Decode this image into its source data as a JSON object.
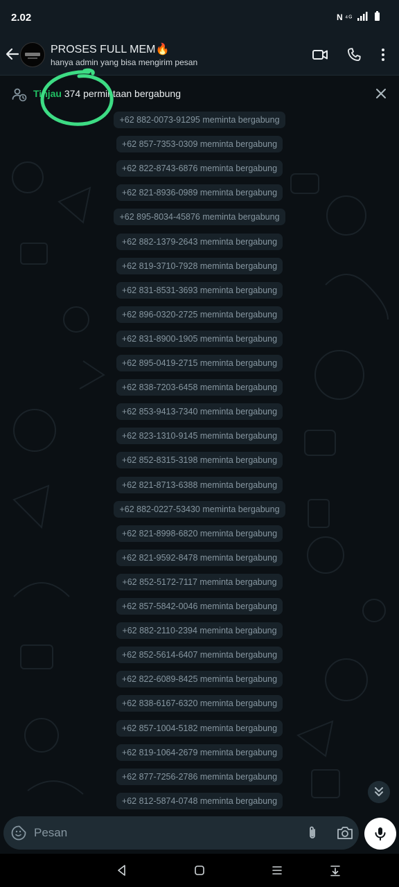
{
  "status_bar": {
    "time": "2.02",
    "icons_text": "N ⁴ᴳ 📶"
  },
  "header": {
    "title": "PROSES FULL MEM",
    "title_emoji": "🔥",
    "subtitle": "hanya admin yang bisa mengirim pesan",
    "icons": [
      "back-arrow-icon",
      "video-call-icon",
      "phone-icon",
      "more-vert-icon"
    ]
  },
  "banner": {
    "link": "Tinjau",
    "text": " 374 permintaan bergabung"
  },
  "messages": [
    "+62 882-0073-91295 meminta bergabung",
    "+62 857-7353-0309 meminta bergabung",
    "+62 822-8743-6876 meminta bergabung",
    "+62 821-8936-0989 meminta bergabung",
    "+62 895-8034-45876 meminta bergabung",
    "+62 882-1379-2643 meminta bergabung",
    "+62 819-3710-7928 meminta bergabung",
    "+62 831-8531-3693 meminta bergabung",
    "+62 896-0320-2725 meminta bergabung",
    "+62 831-8900-1905 meminta bergabung",
    "+62 895-0419-2715 meminta bergabung",
    "+62 838-7203-6458 meminta bergabung",
    "+62 853-9413-7340 meminta bergabung",
    "+62 823-1310-9145 meminta bergabung",
    "+62 852-8315-3198 meminta bergabung",
    "+62 821-8713-6388 meminta bergabung",
    "+62 882-0227-53430 meminta bergabung",
    "+62 821-8998-6820 meminta bergabung",
    "+62 821-9592-8478 meminta bergabung",
    "+62 852-5172-7117 meminta bergabung",
    "+62 857-5842-0046 meminta bergabung",
    "+62 882-2110-2394 meminta bergabung",
    "+62 852-5614-6407 meminta bergabung",
    "+62 822-6089-8425 meminta bergabung",
    "+62 838-6167-6320 meminta bergabung",
    "+62 857-1004-5182 meminta bergabung",
    "+62 819-1064-2679 meminta bergabung",
    "+62 877-7256-2786 meminta bergabung",
    "+62 812-5874-0748 meminta bergabung"
  ],
  "composer": {
    "placeholder": "Pesan"
  },
  "colors": {
    "accent": "#21c063",
    "header_bg": "#121b22",
    "chat_bg": "#0b1014",
    "pill_bg": "#182229",
    "pill_text": "#8696a0",
    "annotation": "#3ddc84"
  }
}
